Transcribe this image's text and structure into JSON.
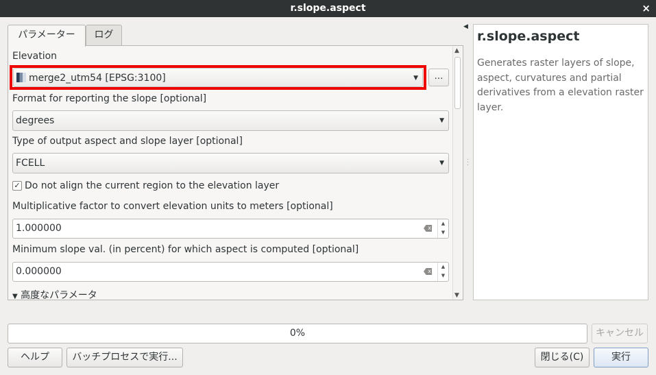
{
  "window": {
    "title": "r.slope.aspect",
    "close_label": "×"
  },
  "tabs": [
    {
      "label": "パラメーター"
    },
    {
      "label": "ログ"
    }
  ],
  "params": {
    "elevation_label": "Elevation",
    "elevation_value": "merge2_utm54 [EPSG:3100]",
    "more_label": "…",
    "format_label": "Format for reporting the slope [optional]",
    "format_value": "degrees",
    "type_label": "Type of output aspect and slope layer [optional]",
    "type_value": "FCELL",
    "align_checkbox_mark": "✓",
    "align_label": "Do not align the current region to the elevation layer",
    "zscale_label": "Multiplicative factor to convert elevation units to meters [optional]",
    "zscale_value": "1.000000",
    "min_slope_label": "Minimum slope val. (in percent) for which aspect is computed [optional]",
    "min_slope_value": "0.000000",
    "advanced_label": "高度なパラメータ"
  },
  "help": {
    "title": "r.slope.aspect",
    "description": "Generates raster layers of slope, aspect, curvatures and partial derivatives from a elevation raster layer."
  },
  "progress": {
    "value": 0.0,
    "text": "0%"
  },
  "buttons": {
    "cancel": "キャンセル",
    "help": "ヘルプ",
    "batch": "バッチプロセスで実行...",
    "close": "閉じる(C)",
    "run": "実行"
  },
  "icons": {
    "dropdown": "▼",
    "up": "▲",
    "expand": "▼",
    "collapse_side": "◀"
  }
}
